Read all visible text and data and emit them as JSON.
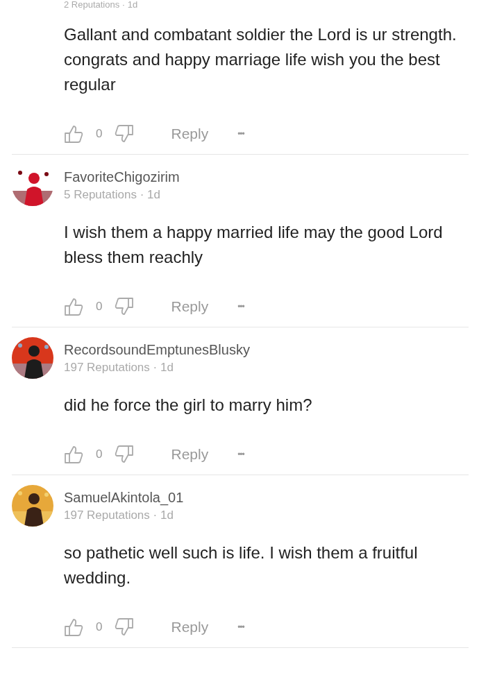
{
  "comments": [
    {
      "meta": "2 Reputations · 1d",
      "body": "Gallant and combatant soldier the Lord is ur strength. congrats and happy marriage life wish you the best regular",
      "likes": "0",
      "reply": "Reply",
      "more": "•••"
    },
    {
      "author": "FavoriteChigozirim",
      "meta": "5 Reputations · 1d",
      "body": " I wish them a happy married life may the good Lord bless them reachly",
      "likes": "0",
      "reply": "Reply",
      "more": "•••"
    },
    {
      "author": "RecordsoundEmptunesBlusky",
      "meta": "197 Reputations · 1d",
      "body": "did he force the girl to marry him?",
      "likes": "0",
      "reply": "Reply",
      "more": "•••"
    },
    {
      "author": "SamuelAkintola_01",
      "meta": "197 Reputations · 1d",
      "body": "so pathetic well such is life. I wish them a fruitful wedding.",
      "likes": "0",
      "reply": "Reply",
      "more": "•••"
    }
  ]
}
